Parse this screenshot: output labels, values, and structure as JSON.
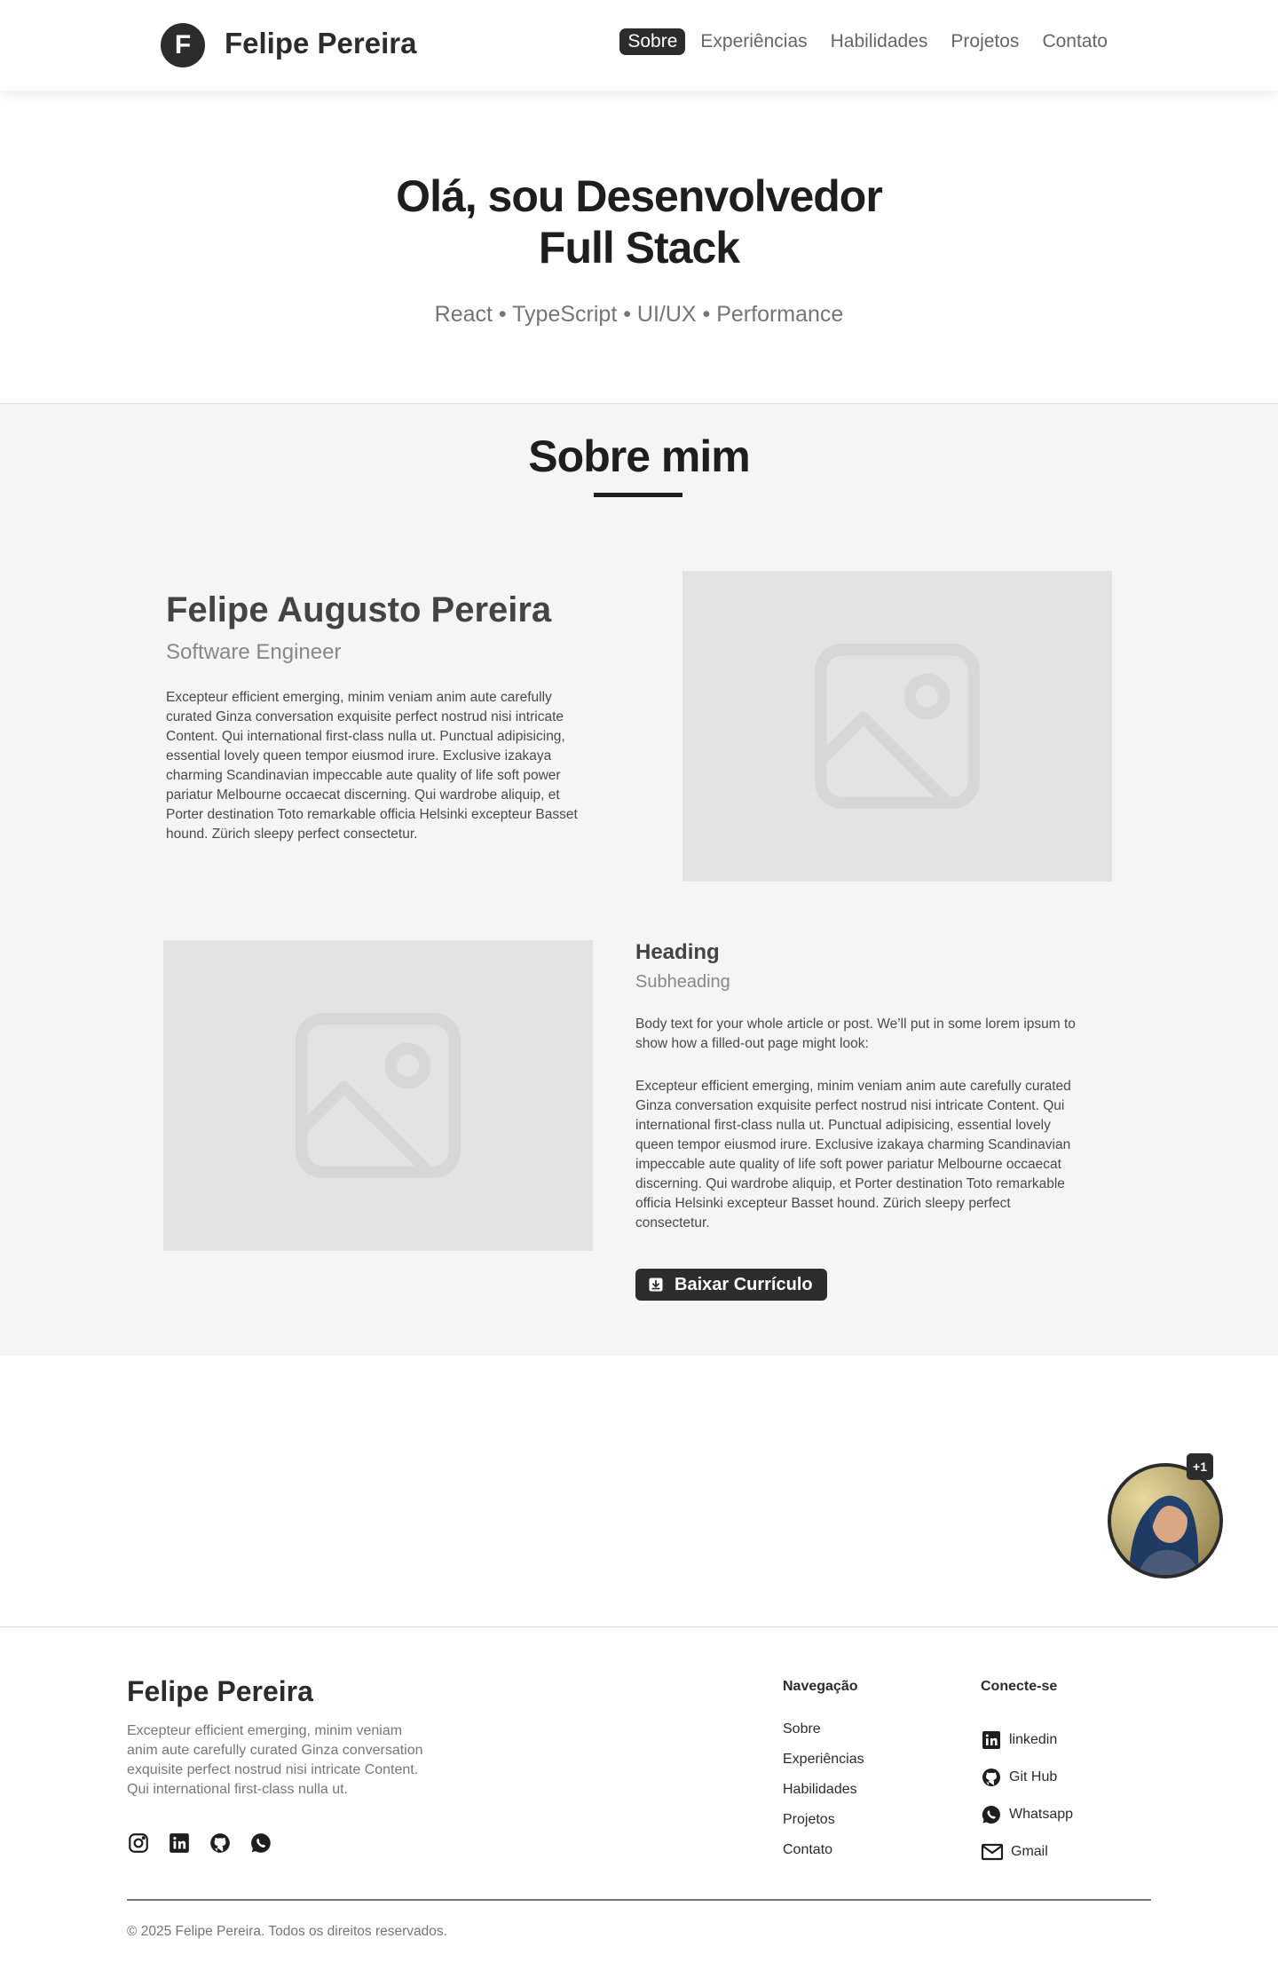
{
  "header": {
    "logo_letter": "F",
    "brand": "Felipe Pereira",
    "nav": [
      "Sobre",
      "Experiências",
      "Habilidades",
      "Projetos",
      "Contato"
    ]
  },
  "hero": {
    "title_line1": "Olá, sou Desenvolvedor",
    "title_line2": "Full Stack",
    "subtitle": "React • TypeScript • UI/UX • Performance"
  },
  "about": {
    "title": "Sobre mim",
    "name": "Felipe Augusto Pereira",
    "role": "Software Engineer",
    "bio": "Excepteur efficient emerging, minim veniam anim aute carefully curated Ginza conversation exquisite perfect nostrud nisi intricate Content. Qui  international first-class nulla ut. Punctual adipisicing, essential lovely queen tempor eiusmod irure. Exclusive izakaya charming Scandinavian impeccable aute quality of life soft power pariatur Melbourne occaecat discerning. Qui wardrobe aliquip, et Porter destination Toto remarkable officia Helsinki excepteur Basset hound. Zürich sleepy perfect consectetur.",
    "card": {
      "heading": "Heading",
      "subheading": "Subheading",
      "body_intro": "Body text for your whole article or post. We’ll put in some lorem ipsum to show how a filled-out page might look:",
      "body_main": "Excepteur efficient emerging, minim veniam anim aute carefully curated Ginza conversation exquisite perfect nostrud nisi intricate Content. Qui  international first-class nulla ut. Punctual adipisicing, essential lovely queen tempor eiusmod irure. Exclusive izakaya charming Scandinavian impeccable aute quality of life soft power pariatur Melbourne occaecat discerning. Qui wardrobe aliquip, et Porter destination Toto remarkable officia Helsinki excepteur Basset hound. Zürich sleepy perfect consectetur.",
      "button": "Baixar Currículo"
    }
  },
  "floating": {
    "badge": "+1"
  },
  "footer": {
    "brand": "Felipe Pereira",
    "description": "Excepteur efficient emerging, minim veniam anim aute carefully curated Ginza conversation exquisite perfect nostrud nisi intricate Content. Qui  international first-class nulla ut.",
    "nav_title": "Navegação",
    "nav": [
      "Sobre",
      "Experiências",
      "Habilidades",
      "Projetos",
      "Contato"
    ],
    "connect_title": "Conecte-se",
    "connect": [
      "linkedin",
      "Git Hub",
      "Whatsapp",
      "Gmail"
    ],
    "socials": [
      "instagram-icon",
      "linkedin-icon",
      "github-icon",
      "whatsapp-icon"
    ],
    "copyright": "© 2025 Felipe Pereira. Todos os direitos reservados."
  },
  "colors": {
    "primary": "#2c2c2c",
    "section_bg": "#f5f5f5",
    "placeholder": "#e3e3e3",
    "muted_text": "#757575"
  }
}
